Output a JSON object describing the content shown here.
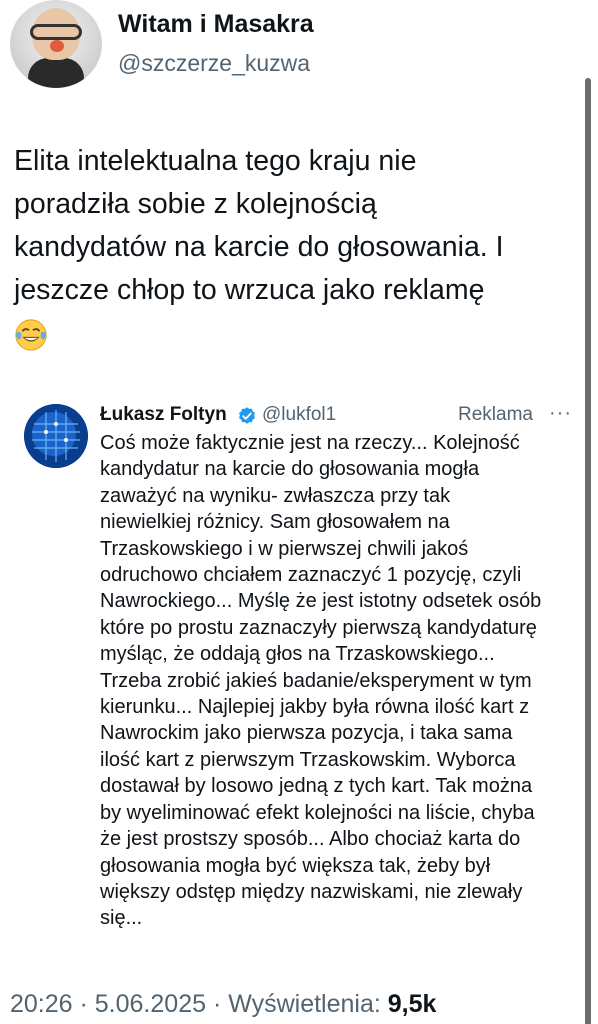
{
  "author": {
    "display_name": "Witam i Masakra",
    "handle": "@szczerze_kuzwa",
    "avatar": "cartoon-character-with-glasses"
  },
  "tweet": {
    "text": "Elita intelektualna tego kraju nie\nporadziła sobie z kolejnością\nkandydatów na karcie do głosowania. I\njeszcze chłop to wrzuca jako reklamę",
    "emoji": "face-with-tears-of-joy"
  },
  "quoted_tweet": {
    "display_name": "Łukasz Foltyn",
    "verified": true,
    "handle": "@lukfol1",
    "label": "Reklama",
    "more_icon": "···",
    "text": "Coś może faktycznie jest na rzeczy... Kolejność\nkandydatur na karcie do głosowania mogła\nzaważyć na wyniku- zwłaszcza przy tak\nniewielkiej różnicy. Sam głosowałem na\nTrzaskowskiego i w pierwszej chwili jakoś\nodruchowo chciałem zaznaczyć 1 pozycję, czyli\nNawrockiego... Myślę że jest istotny odsetek osób\nktóre po prostu zaznaczyły pierwszą kandydaturę\nmyśląc, że oddają głos na Trzaskowskiego...\nTrzeba zrobić jakieś badanie/eksperyment w tym\nkierunku... Najlepiej jakby była równa ilość kart z\nNawrockim jako pierwsza pozycja, i taka sama\nilość kart z pierwszym Trzaskowskim. Wyborca\ndostawał by losowo jedną z tych kart. Tak można\nby wyeliminować efekt kolejności na liście, chyba\nże jest prostszy sposób... Albo chociaż karta do\ngłosowania mogła być większa tak, żeby był\nwiększy odstęp między nazwiskami, nie zlewały\nsię..."
  },
  "meta": {
    "time_date": "20:26 · 5.06.2025 · Wyświetlenia: ",
    "views": "9,5k"
  },
  "colors": {
    "text_primary": "#0f1419",
    "text_secondary": "#536471",
    "verified_blue": "#1d9bf0"
  }
}
